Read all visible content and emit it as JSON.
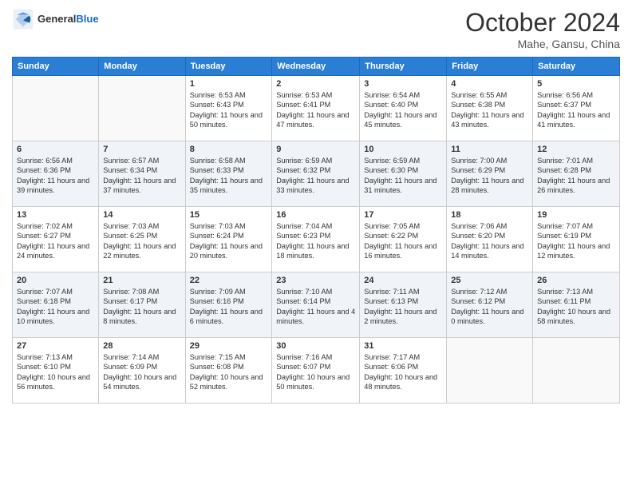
{
  "header": {
    "logo_general": "General",
    "logo_blue": "Blue",
    "month": "October 2024",
    "location": "Mahe, Gansu, China"
  },
  "weekdays": [
    "Sunday",
    "Monday",
    "Tuesday",
    "Wednesday",
    "Thursday",
    "Friday",
    "Saturday"
  ],
  "weeks": [
    [
      {
        "day": "",
        "info": ""
      },
      {
        "day": "",
        "info": ""
      },
      {
        "day": "1",
        "info": "Sunrise: 6:53 AM\nSunset: 6:43 PM\nDaylight: 11 hours and 50 minutes."
      },
      {
        "day": "2",
        "info": "Sunrise: 6:53 AM\nSunset: 6:41 PM\nDaylight: 11 hours and 47 minutes."
      },
      {
        "day": "3",
        "info": "Sunrise: 6:54 AM\nSunset: 6:40 PM\nDaylight: 11 hours and 45 minutes."
      },
      {
        "day": "4",
        "info": "Sunrise: 6:55 AM\nSunset: 6:38 PM\nDaylight: 11 hours and 43 minutes."
      },
      {
        "day": "5",
        "info": "Sunrise: 6:56 AM\nSunset: 6:37 PM\nDaylight: 11 hours and 41 minutes."
      }
    ],
    [
      {
        "day": "6",
        "info": "Sunrise: 6:56 AM\nSunset: 6:36 PM\nDaylight: 11 hours and 39 minutes."
      },
      {
        "day": "7",
        "info": "Sunrise: 6:57 AM\nSunset: 6:34 PM\nDaylight: 11 hours and 37 minutes."
      },
      {
        "day": "8",
        "info": "Sunrise: 6:58 AM\nSunset: 6:33 PM\nDaylight: 11 hours and 35 minutes."
      },
      {
        "day": "9",
        "info": "Sunrise: 6:59 AM\nSunset: 6:32 PM\nDaylight: 11 hours and 33 minutes."
      },
      {
        "day": "10",
        "info": "Sunrise: 6:59 AM\nSunset: 6:30 PM\nDaylight: 11 hours and 31 minutes."
      },
      {
        "day": "11",
        "info": "Sunrise: 7:00 AM\nSunset: 6:29 PM\nDaylight: 11 hours and 28 minutes."
      },
      {
        "day": "12",
        "info": "Sunrise: 7:01 AM\nSunset: 6:28 PM\nDaylight: 11 hours and 26 minutes."
      }
    ],
    [
      {
        "day": "13",
        "info": "Sunrise: 7:02 AM\nSunset: 6:27 PM\nDaylight: 11 hours and 24 minutes."
      },
      {
        "day": "14",
        "info": "Sunrise: 7:03 AM\nSunset: 6:25 PM\nDaylight: 11 hours and 22 minutes."
      },
      {
        "day": "15",
        "info": "Sunrise: 7:03 AM\nSunset: 6:24 PM\nDaylight: 11 hours and 20 minutes."
      },
      {
        "day": "16",
        "info": "Sunrise: 7:04 AM\nSunset: 6:23 PM\nDaylight: 11 hours and 18 minutes."
      },
      {
        "day": "17",
        "info": "Sunrise: 7:05 AM\nSunset: 6:22 PM\nDaylight: 11 hours and 16 minutes."
      },
      {
        "day": "18",
        "info": "Sunrise: 7:06 AM\nSunset: 6:20 PM\nDaylight: 11 hours and 14 minutes."
      },
      {
        "day": "19",
        "info": "Sunrise: 7:07 AM\nSunset: 6:19 PM\nDaylight: 11 hours and 12 minutes."
      }
    ],
    [
      {
        "day": "20",
        "info": "Sunrise: 7:07 AM\nSunset: 6:18 PM\nDaylight: 11 hours and 10 minutes."
      },
      {
        "day": "21",
        "info": "Sunrise: 7:08 AM\nSunset: 6:17 PM\nDaylight: 11 hours and 8 minutes."
      },
      {
        "day": "22",
        "info": "Sunrise: 7:09 AM\nSunset: 6:16 PM\nDaylight: 11 hours and 6 minutes."
      },
      {
        "day": "23",
        "info": "Sunrise: 7:10 AM\nSunset: 6:14 PM\nDaylight: 11 hours and 4 minutes."
      },
      {
        "day": "24",
        "info": "Sunrise: 7:11 AM\nSunset: 6:13 PM\nDaylight: 11 hours and 2 minutes."
      },
      {
        "day": "25",
        "info": "Sunrise: 7:12 AM\nSunset: 6:12 PM\nDaylight: 11 hours and 0 minutes."
      },
      {
        "day": "26",
        "info": "Sunrise: 7:13 AM\nSunset: 6:11 PM\nDaylight: 10 hours and 58 minutes."
      }
    ],
    [
      {
        "day": "27",
        "info": "Sunrise: 7:13 AM\nSunset: 6:10 PM\nDaylight: 10 hours and 56 minutes."
      },
      {
        "day": "28",
        "info": "Sunrise: 7:14 AM\nSunset: 6:09 PM\nDaylight: 10 hours and 54 minutes."
      },
      {
        "day": "29",
        "info": "Sunrise: 7:15 AM\nSunset: 6:08 PM\nDaylight: 10 hours and 52 minutes."
      },
      {
        "day": "30",
        "info": "Sunrise: 7:16 AM\nSunset: 6:07 PM\nDaylight: 10 hours and 50 minutes."
      },
      {
        "day": "31",
        "info": "Sunrise: 7:17 AM\nSunset: 6:06 PM\nDaylight: 10 hours and 48 minutes."
      },
      {
        "day": "",
        "info": ""
      },
      {
        "day": "",
        "info": ""
      }
    ]
  ]
}
